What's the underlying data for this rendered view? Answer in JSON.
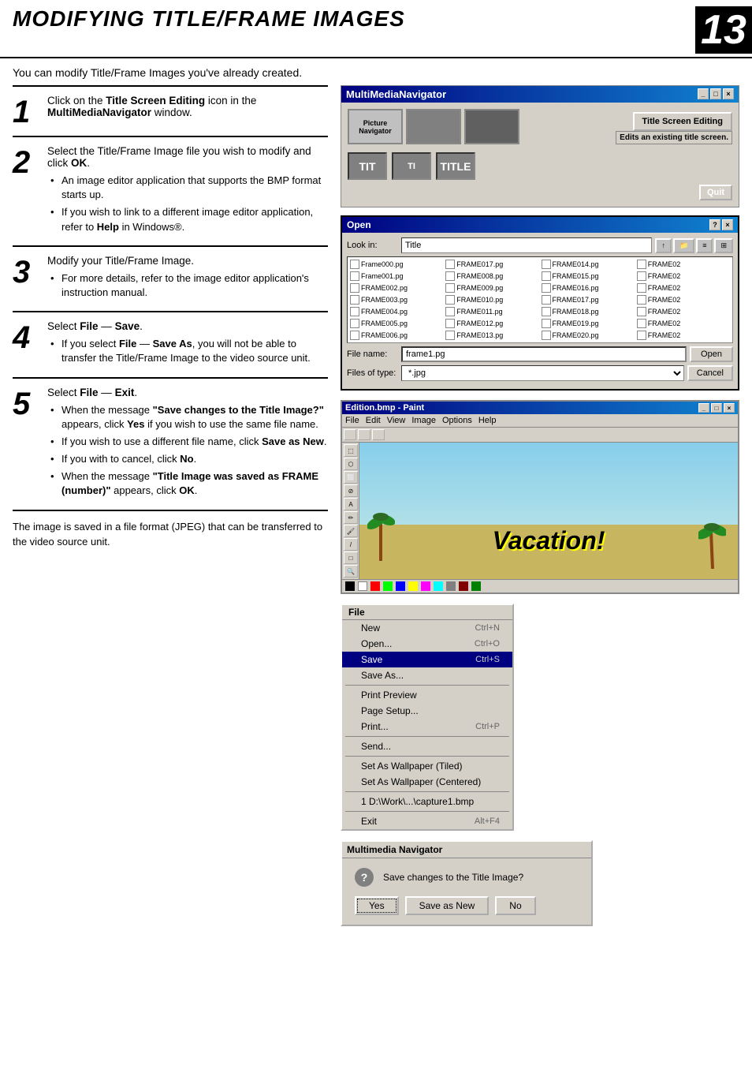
{
  "header": {
    "title": "MODIFYING TITLE/FRAME IMAGES",
    "page_number": "13"
  },
  "subtitle": "You can modify Title/Frame Images you've already created.",
  "steps": [
    {
      "number": "1",
      "main": "Click on the <b>Title Screen Editing</b> icon in the <b>MultiMediaNavigator</b> window.",
      "bullets": []
    },
    {
      "number": "2",
      "main": "Select the Title/Frame Image file you wish to modify and click <b>OK</b>.",
      "bullets": [
        "An image editor application that supports the BMP format starts up.",
        "If you wish to link to a different image editor application, refer to <b>Help</b> in Windows®."
      ]
    },
    {
      "number": "3",
      "main": "Modify your Title/Frame Image.",
      "bullets": [
        "For more details, refer to the image editor application's instruction manual."
      ]
    },
    {
      "number": "4",
      "main": "Select <b>File</b> — <b>Save</b>.",
      "bullets": [
        "If you select <b>File</b> — <b>Save As</b>, you will not be able to transfer the Title/Frame Image to the video source unit."
      ]
    },
    {
      "number": "5",
      "main": "Select <b>File</b> — <b>Exit</b>.",
      "bullets": [
        "When the message <b>\"Save changes to the Title Image?\"</b> appears, click <b>Yes</b> if you wish to use the same file name.",
        "If you wish to use a different file name, click <b>Save as New</b>.",
        "If you with to cancel, click <b>No</b>.",
        "When the message <b>\"Title Image was saved as FRAME (number)\"</b> appears, click <b>OK</b>."
      ]
    }
  ],
  "bottom_text": "The image is saved in a file format (JPEG) that can be transferred to the video source unit.",
  "mmn_window": {
    "title": "MultiMediaNavigator",
    "picture_navigator": "Picture Navigator",
    "title_screen_editing": "Title Screen Editing",
    "edits_existing": "Edits an existing title screen.",
    "quit": "Quit",
    "title_icons": [
      "TIT",
      "TI",
      "TITLE"
    ]
  },
  "open_dialog": {
    "title": "Open",
    "look_in_label": "Look in:",
    "look_in_value": "Title",
    "file_name_label": "File name:",
    "file_name_value": "frame1.pg",
    "files_of_type_label": "Files of type:",
    "files_of_type_value": "*.jpg",
    "open_button": "Open",
    "cancel_button": "Cancel",
    "files": [
      "Frame000.pg",
      "FRAME017.pg",
      "FRAME014.pg",
      "FRAME02",
      "Frame001.pg",
      "FRAME008.pg",
      "FRAME015.pg",
      "FRAME02",
      "FRAME002.pg",
      "FRAME009.pg",
      "FRAME016.pg",
      "FRAME02",
      "FRAME003.pg",
      "FRAME010.pg",
      "FRAME017.pg",
      "FRAME02",
      "FRAME004.pg",
      "FRAME011.pg",
      "FRAME018.pg",
      "FRAME02",
      "FRAME005.pg",
      "FRAME012.pg",
      "FRAME019.pg",
      "FRAME02",
      "FRAME006.pg",
      "FRAME013.pg",
      "FRAME020.pg",
      "FRAME02"
    ]
  },
  "paint_window": {
    "title": "Edition.bmp - Paint",
    "menus": [
      "File",
      "Edit",
      "View",
      "Image",
      "Options",
      "Help"
    ],
    "vacation_text": "Vacation!"
  },
  "file_menu": {
    "header": "File",
    "items": [
      {
        "label": "New",
        "shortcut": "Ctrl+N",
        "separator_after": false
      },
      {
        "label": "Open...",
        "shortcut": "Ctrl+O",
        "separator_after": false
      },
      {
        "label": "Save",
        "shortcut": "Ctrl+S",
        "highlighted": true,
        "separator_after": false
      },
      {
        "label": "Save As...",
        "shortcut": "",
        "separator_after": true
      },
      {
        "label": "Print Preview",
        "shortcut": "",
        "separator_after": false
      },
      {
        "label": "Page Setup...",
        "shortcut": "",
        "separator_after": false
      },
      {
        "label": "Print...",
        "shortcut": "Ctrl+P",
        "separator_after": true
      },
      {
        "label": "Send...",
        "shortcut": "",
        "separator_after": true
      },
      {
        "label": "Set As Wallpaper (Tiled)",
        "shortcut": "",
        "separator_after": false
      },
      {
        "label": "Set As Wallpaper (Centered)",
        "shortcut": "",
        "separator_after": true
      },
      {
        "label": "1 D:\\Work\\...\\capture1.bmp",
        "shortcut": "",
        "separator_after": true
      },
      {
        "label": "Exit",
        "shortcut": "Alt+F4",
        "separator_after": false
      }
    ]
  },
  "mmn_dialog": {
    "title": "Multimedia Navigator",
    "message": "Save changes to the Title Image?",
    "yes_button": "Yes",
    "save_as_new_button": "Save as New",
    "no_button": "No"
  }
}
